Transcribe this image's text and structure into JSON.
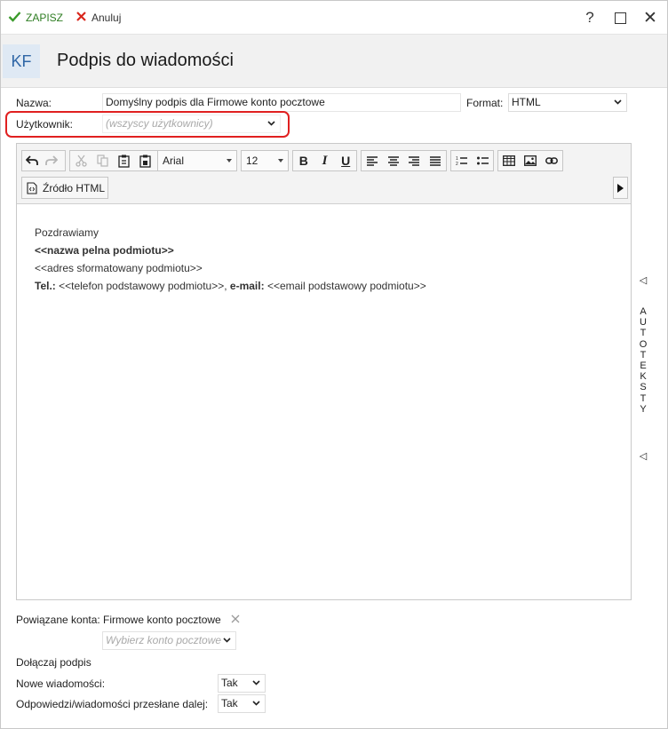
{
  "toolbar": {
    "save_label": "ZAPISZ",
    "cancel_label": "Anuluj",
    "help_label": "?",
    "close_label": "✕"
  },
  "header": {
    "badge": "KF",
    "title": "Podpis do wiadomości"
  },
  "form": {
    "name_label": "Nazwa:",
    "name_value": "Domyślny podpis dla Firmowe konto pocztowe",
    "format_label": "Format:",
    "format_value": "HTML",
    "user_label": "Użytkownik:",
    "user_placeholder": "(wszyscy użytkownicy)"
  },
  "editor": {
    "font_name": "Arial",
    "font_size": "12",
    "source_button": "Źródło HTML",
    "bold_label": "B",
    "italic_label": "I",
    "underline_label": "U",
    "content": {
      "line1": "Pozdrawiamy",
      "line2": "<<nazwa pelna podmiotu>>",
      "line3": "<<adres sformatowany podmiotu>>",
      "line4_label1": "Tel.:",
      "line4_value1": " <<telefon podstawowy podmiotu>>, ",
      "line4_label2": "e-mail:",
      "line4_value2": " <<email podstawowy podmiotu>>"
    }
  },
  "side_panel": {
    "label": "AUTOTEKSTY",
    "arrow": "◁"
  },
  "bottom": {
    "linked_label": "Powiązane konta:",
    "linked_value": "Firmowe konto pocztowe",
    "choose_placeholder": "Wybierz konto pocztowe",
    "attach_label": "Dołączaj podpis",
    "new_messages_label": "Nowe wiadomości:",
    "new_messages_value": "Tak",
    "replies_label": "Odpowiedzi/wiadomości przesłane dalej:",
    "replies_value": "Tak"
  },
  "colors": {
    "save_green": "#3a9a2a",
    "cancel_red": "#d9261c",
    "highlight_red": "#e02020",
    "badge_blue": "#2f66a6"
  }
}
